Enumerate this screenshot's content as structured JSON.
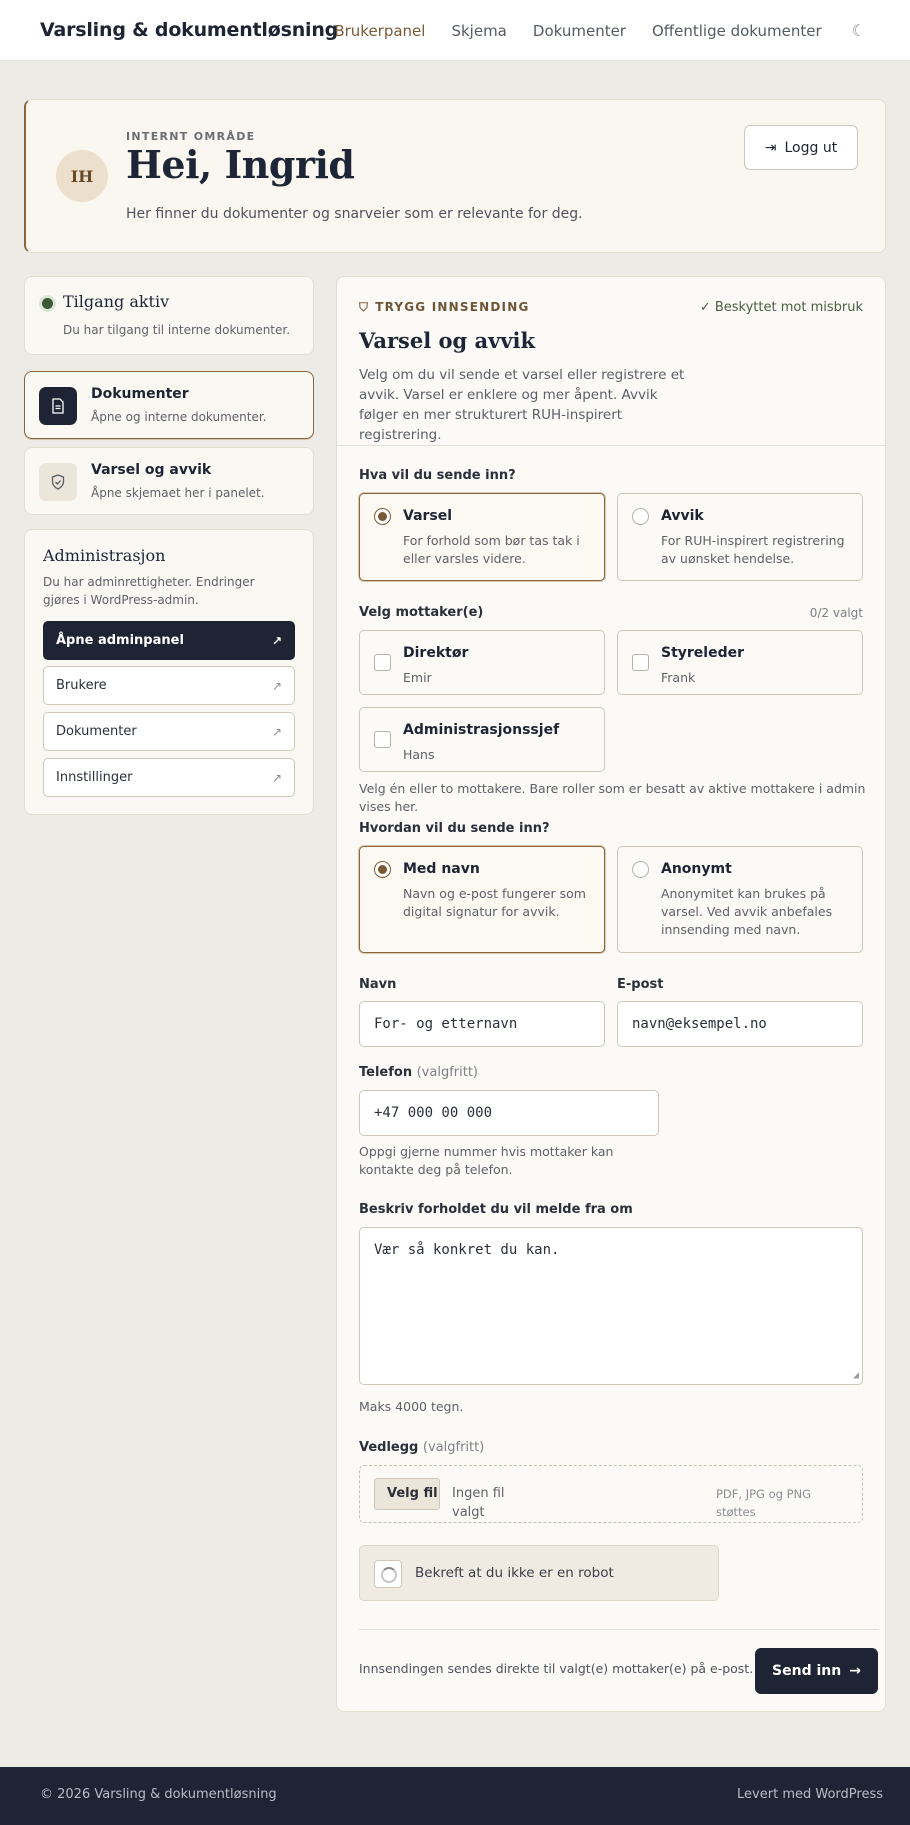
{
  "header": {
    "brand": "Varsling & dokumentløsning",
    "nav": [
      "Brukerpanel",
      "Skjema",
      "Dokumenter",
      "Offentlige dokumenter"
    ],
    "active_nav": "Brukerpanel",
    "theme_icon": "moon-icon"
  },
  "hero": {
    "initials": "IH",
    "eyebrow": "INTERNT OMRÅDE",
    "title": "Hei, Ingrid",
    "subtitle": "Her finner du dokumenter og snarveier som er relevante for deg.",
    "logout_label": "Logg ut",
    "logout_icon": "logout-icon"
  },
  "sidebar": {
    "status": {
      "title": "Tilgang aktiv",
      "subtitle": "Du har tilgang til interne dokumenter."
    },
    "cards": [
      {
        "title": "Dokumenter",
        "subtitle": "Åpne og interne dokumenter.",
        "icon": "document-icon",
        "active": true
      },
      {
        "title": "Varsel og avvik",
        "subtitle": "Åpne skjemaet her i panelet.",
        "icon": "shield-icon",
        "active": false
      }
    ],
    "admin": {
      "title": "Administrasjon",
      "description": "Du har adminrettigheter. Endringer gjøres i WordPress-admin.",
      "buttons": [
        "Åpne adminpanel",
        "Brukere",
        "Dokumenter",
        "Innstillinger"
      ]
    }
  },
  "form": {
    "eyebrow": "TRYGG INNSENDING",
    "protected": "Beskyttet mot misbruk",
    "title": "Varsel og avvik",
    "intro": "Velg om du vil sende et varsel eller registrere et avvik. Varsel er enklere og mer åpent. Avvik følger en mer strukturert RUH-inspirert registrering.",
    "type_label": "Hva vil du sende inn?",
    "types": [
      {
        "title": "Varsel",
        "desc": "For forhold som bør tas tak i eller varsles videre.",
        "selected": true
      },
      {
        "title": "Avvik",
        "desc": "For RUH-inspirert registrering av uønsket hendelse.",
        "selected": false
      }
    ],
    "recipients_label": "Velg mottaker(e)",
    "recipients_counter": "0/2 valgt",
    "recipients": [
      {
        "role": "Direktør",
        "name": "Emir"
      },
      {
        "role": "Styreleder",
        "name": "Frank"
      },
      {
        "role": "Administrasjonssjef",
        "name": "Hans"
      }
    ],
    "recipients_help": "Velg én eller to mottakere. Bare roller som er besatt av aktive mottakere i admin vises her.",
    "mode_label": "Hvordan vil du sende inn?",
    "modes": [
      {
        "title": "Med navn",
        "desc": "Navn og e-post fungerer som digital signatur for avvik.",
        "selected": true
      },
      {
        "title": "Anonymt",
        "desc": "Anonymitet kan brukes på varsel. Ved avvik anbefales innsending med navn.",
        "selected": false
      }
    ],
    "name_label": "Navn",
    "name_placeholder": "For- og etternavn",
    "email_label": "E-post",
    "email_placeholder": "navn@eksempel.no",
    "phone_label": "Telefon",
    "phone_optional": "(valgfritt)",
    "phone_placeholder": "+47 000 00 000",
    "phone_help": "Oppgi gjerne nummer hvis mottaker kan kontakte deg på telefon.",
    "description_label": "Beskriv forholdet du vil melde fra om",
    "description_placeholder": "Vær så konkret du kan.",
    "description_help": "Maks 4000 tegn.",
    "attachment_label": "Vedlegg",
    "attachment_optional": "(valgfritt)",
    "file_button": "Velg fil",
    "no_file": "Ingen fil valgt",
    "file_hint": "PDF, JPG og PNG støttes",
    "captcha_label": "Bekreft at du ikke er en robot",
    "footnote": "Innsendingen sendes direkte til valgt(e) mottaker(e) på e-post.",
    "submit_label": "Send inn"
  },
  "footer": {
    "copyright": "© 2026 Varsling & dokumentløsning",
    "powered": "Levert med WordPress"
  }
}
